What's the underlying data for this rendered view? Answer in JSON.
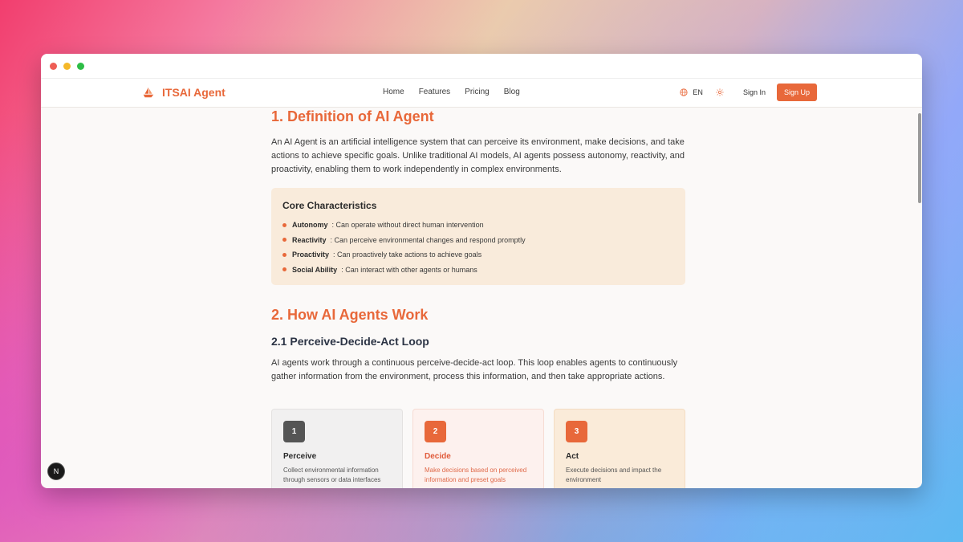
{
  "brand": {
    "name": "ITSAI Agent",
    "accent": "#e8683a"
  },
  "nav": {
    "links": [
      "Home",
      "Features",
      "Pricing",
      "Blog"
    ],
    "language": "EN",
    "signin": "Sign In",
    "signup": "Sign Up"
  },
  "section1": {
    "title": "1. Definition of AI Agent",
    "paragraph": "An AI Agent is an artificial intelligence system that can perceive its environment, make decisions, and take actions to achieve specific goals. Unlike traditional AI models, AI agents possess autonomy, reactivity, and proactivity, enabling them to work independently in complex environments.",
    "core": {
      "title": "Core Characteristics",
      "items": [
        {
          "term": "Autonomy",
          "desc": "Can operate without direct human intervention"
        },
        {
          "term": "Reactivity",
          "desc": "Can perceive environmental changes and respond promptly"
        },
        {
          "term": "Proactivity",
          "desc": "Can proactively take actions to achieve goals"
        },
        {
          "term": "Social Ability",
          "desc": "Can interact with other agents or humans"
        }
      ]
    }
  },
  "section2": {
    "title": "2. How AI Agents Work",
    "subtitle": "2.1 Perceive-Decide-Act Loop",
    "paragraph": "AI agents work through a continuous perceive-decide-act loop. This loop enables agents to continuously gather information from the environment, process this information, and then take appropriate actions.",
    "cards": [
      {
        "num": "1",
        "title": "Perceive",
        "desc": "Collect environmental information through sensors or data interfaces"
      },
      {
        "num": "2",
        "title": "Decide",
        "desc": "Make decisions based on perceived information and preset goals"
      },
      {
        "num": "3",
        "title": "Act",
        "desc": "Execute decisions and impact the environment"
      }
    ]
  },
  "badge": {
    "label": "N"
  }
}
